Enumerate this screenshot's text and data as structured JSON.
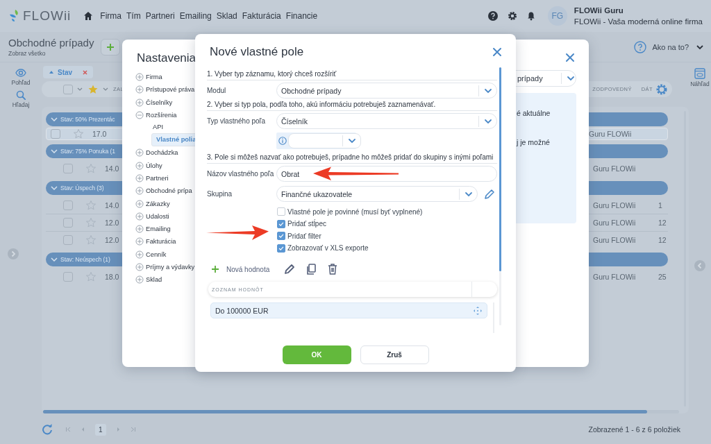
{
  "header": {
    "logo": "FLOWii",
    "nav": [
      {
        "label": "Firma"
      },
      {
        "label": "Tím"
      },
      {
        "label": "Partneri"
      },
      {
        "label": "Emailing"
      },
      {
        "label": "Sklad"
      },
      {
        "label": "Fakturácia"
      },
      {
        "label": "Financie"
      }
    ],
    "user": {
      "initials": "FG",
      "name": "FLOWii Guru",
      "company": "FLOWii - Vaša moderná online firma"
    }
  },
  "page": {
    "title": "Obchodné prípady",
    "subtitle": "Zobraz všetko",
    "help": "Ako na to?"
  },
  "left_rail": [
    {
      "label": "Pohľad",
      "kind": "view"
    },
    {
      "label": "Hľadaj",
      "kind": "search"
    }
  ],
  "right_rail": [
    {
      "label": "Náhľad"
    }
  ],
  "filter_chip": {
    "label": "Stav"
  },
  "table": {
    "all_checked": false,
    "columns": [
      {
        "label": "ZAL"
      },
      {
        "label": "ZODPOVEDNÝ"
      },
      {
        "label": "DÁT"
      }
    ],
    "groups": [
      {
        "label": "Stav: 50% Prezentác",
        "rows": [
          {
            "selected": true,
            "checked": false,
            "starred": false,
            "column_1": "17.0",
            "responsible": "Guru FLOWii"
          }
        ]
      },
      {
        "label": "Stav: 75% Ponuka (1",
        "rows": [
          {
            "selected": false,
            "checked": false,
            "starred": false,
            "column_1": "14.0",
            "responsible": "Guru FLOWii"
          }
        ]
      },
      {
        "label": "Stav: Úspech (3)",
        "rows": [
          {
            "selected": false,
            "checked": false,
            "starred": false,
            "column_1": "14.0",
            "responsible": "Guru FLOWii",
            "column_3": "1"
          },
          {
            "selected": false,
            "checked": false,
            "starred": false,
            "column_1": "12.0",
            "responsible": "Guru FLOWii",
            "column_3": "12"
          },
          {
            "selected": false,
            "checked": false,
            "starred": false,
            "column_1": "12.0",
            "responsible": "Guru FLOWii",
            "column_3": "12"
          }
        ]
      },
      {
        "label": "Stav: Neúspech (1)",
        "rows": [
          {
            "selected": false,
            "checked": false,
            "starred": false,
            "column_1": "18.0",
            "responsible": "Guru FLOWii",
            "column_3": "25"
          }
        ]
      }
    ]
  },
  "pagination": {
    "page": "1",
    "summary": "Zobrazené 1 - 6 z 6 položiek"
  },
  "settings_dialog": {
    "title": "Nastavenia",
    "tree": [
      {
        "label": "Firma",
        "expanded": false
      },
      {
        "label": "Prístupové práva",
        "expanded": false
      },
      {
        "label": "Číselníky",
        "expanded": false
      },
      {
        "label": "Rozšírenia",
        "expanded": true,
        "children": [
          {
            "label": "API",
            "selected": false
          },
          {
            "label": "Vlastné polia",
            "selected": true
          }
        ]
      },
      {
        "label": "Dochádzka",
        "expanded": false
      },
      {
        "label": "Úlohy",
        "expanded": false
      },
      {
        "label": "Partneri",
        "expanded": false
      },
      {
        "label": "Obchodné prípa",
        "expanded": false
      },
      {
        "label": "Zákazky",
        "expanded": false
      },
      {
        "label": "Udalosti",
        "expanded": false
      },
      {
        "label": "Emailing",
        "expanded": false
      },
      {
        "label": "Fakturácia",
        "expanded": false
      },
      {
        "label": "Cenník",
        "expanded": false
      },
      {
        "label": "Príjmy a výdavky",
        "expanded": false
      },
      {
        "label": "Sklad",
        "expanded": false
      }
    ],
    "module_select": "prípady",
    "info_lines": [
      "é aktuálne",
      "j je možné"
    ]
  },
  "field_dialog": {
    "title": "Nové vlastné pole",
    "step_1": "1. Vyber typ záznamu, ktorý chceš rozšíriť",
    "module": {
      "label": "Modul",
      "value": "Obchodné prípady"
    },
    "step_2": "2. Vyber si typ pola, podľa toho, akú informáciu potrebuješ zaznamenávať.",
    "field_type": {
      "label": "Typ vlastného poľa",
      "value": "Číselník"
    },
    "step_3": "3. Pole si môžeš nazvať ako potrebuješ, prípadne ho môžeš pridať do skupiny s inými poľami",
    "field_name": {
      "label": "Názov vlastného poľa",
      "value": "Obrat"
    },
    "group": {
      "label": "Skupina",
      "value": "Finančné ukazovatele"
    },
    "options": [
      {
        "label": "Vlastné pole je povinné (musí byť vyplnené)",
        "checked": false
      },
      {
        "label": "Pridať stĺpec",
        "checked": true
      },
      {
        "label": "Pridať filter",
        "checked": true
      },
      {
        "label": "Zobrazovať v XLS exporte",
        "checked": true
      }
    ],
    "new_value_button": "Nová hodnota",
    "values_header": "ZOZNAM HODNÔT",
    "values": [
      {
        "label": "Do 100000 EUR",
        "selected": true
      }
    ],
    "buttons": [
      {
        "label": "OK",
        "kind": "primary"
      },
      {
        "label": "Zruš",
        "kind": "secondary"
      }
    ]
  }
}
